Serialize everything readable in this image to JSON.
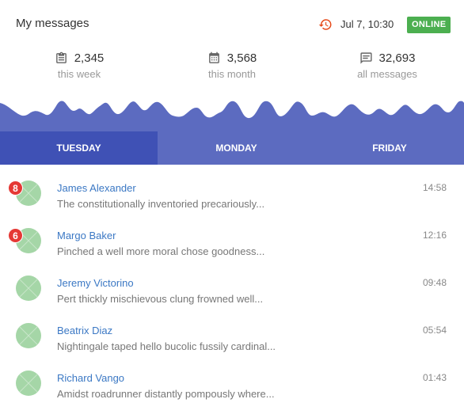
{
  "header": {
    "title": "My messages",
    "datetime": "Jul 7, 10:30",
    "status": "ONLINE",
    "history_icon": "history-icon"
  },
  "stats": [
    {
      "icon": "clipboard-icon",
      "value": "2,345",
      "label": "this week"
    },
    {
      "icon": "calendar-icon",
      "value": "3,568",
      "label": "this month"
    },
    {
      "icon": "message-icon",
      "value": "32,693",
      "label": "all messages"
    }
  ],
  "tabs": [
    {
      "label": "TUESDAY",
      "active": true
    },
    {
      "label": "MONDAY",
      "active": false
    },
    {
      "label": "FRIDAY",
      "active": false
    }
  ],
  "messages": [
    {
      "name": "James Alexander",
      "preview": "The constitutionally inventoried precariously...",
      "time": "14:58",
      "unread": "8"
    },
    {
      "name": "Margo Baker",
      "preview": "Pinched a well more moral chose goodness...",
      "time": "12:16",
      "unread": "6"
    },
    {
      "name": "Jeremy Victorino",
      "preview": "Pert thickly mischievous clung frowned well...",
      "time": "09:48",
      "unread": ""
    },
    {
      "name": "Beatrix Diaz",
      "preview": "Nightingale taped hello bucolic fussily cardinal...",
      "time": "05:54",
      "unread": ""
    },
    {
      "name": "Richard Vango",
      "preview": "Amidst roadrunner distantly pompously where...",
      "time": "01:43",
      "unread": ""
    }
  ],
  "colors": {
    "accent": "#5c6bc0",
    "accent_dark": "#3f51b5",
    "online": "#4caf50",
    "unread_badge": "#e53935",
    "link": "#3b78c4",
    "avatar": "#a5d6a7",
    "history_icon": "#e64a19"
  }
}
